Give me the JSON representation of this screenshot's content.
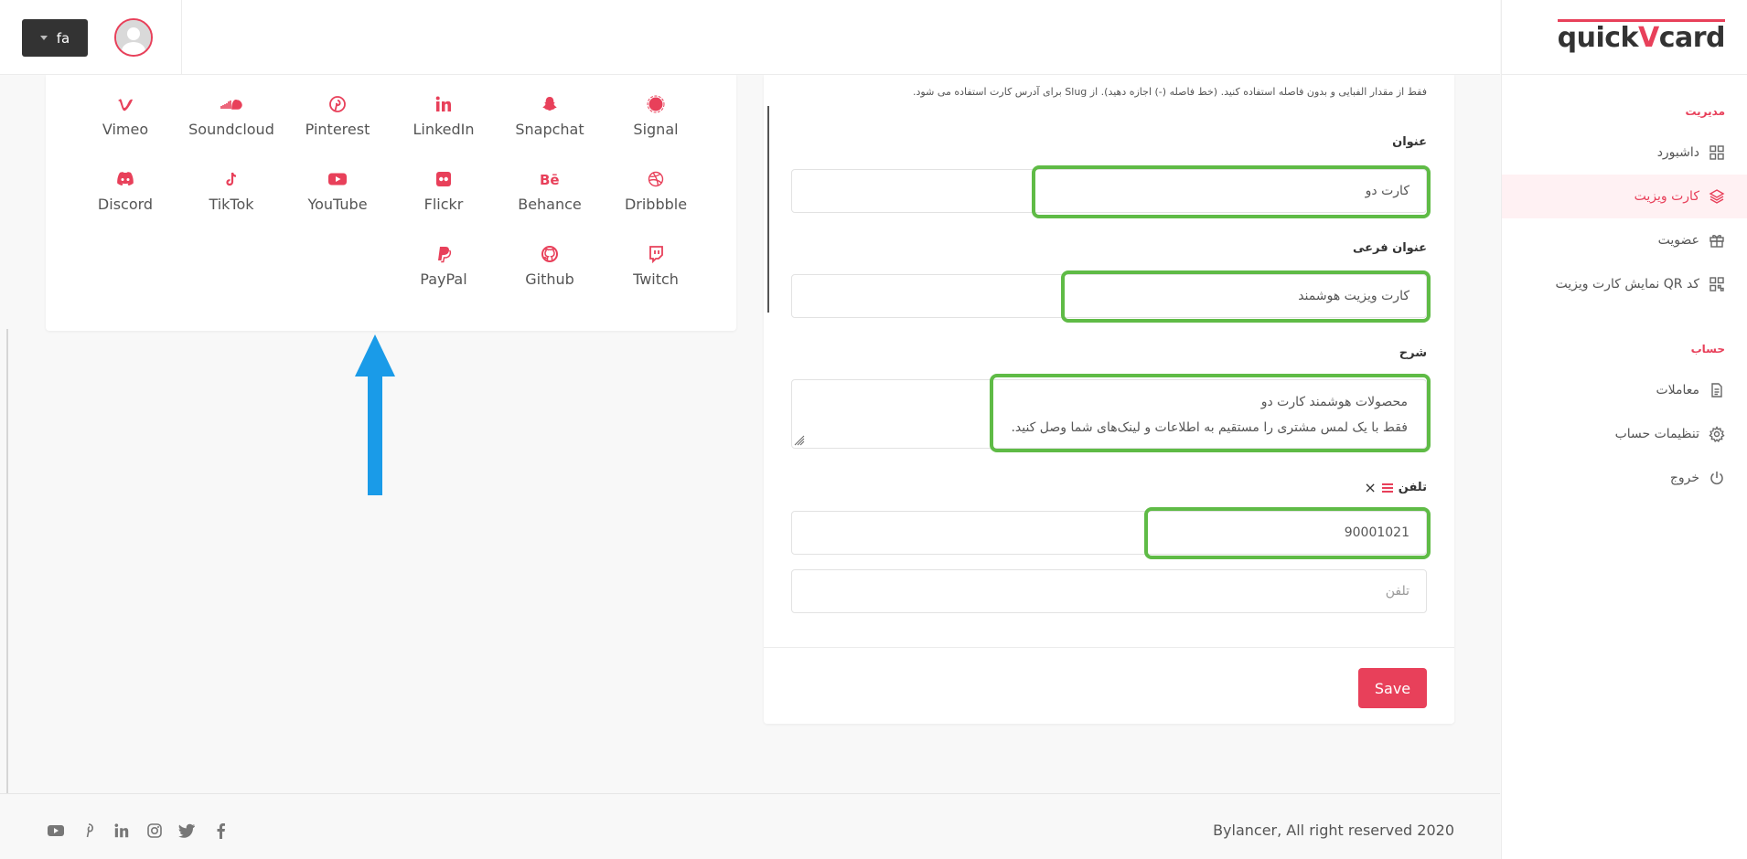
{
  "header": {
    "language_label": "fa",
    "logo_text_a": "quick",
    "logo_text_v": "V",
    "logo_text_b": "card"
  },
  "sidebar": {
    "section_admin": "مدیریت",
    "section_account": "حساب",
    "items": [
      {
        "label": "داشبورد",
        "icon": "dashboard-icon",
        "active": false
      },
      {
        "label": "کارت ویزیت",
        "icon": "layers-icon",
        "active": true
      },
      {
        "label": "عضویت",
        "icon": "gift-icon",
        "active": false
      },
      {
        "label": "کد QR نمایش کارت ویزیت",
        "icon": "qr-icon",
        "active": false
      },
      {
        "label": "معاملات",
        "icon": "document-icon",
        "active": false
      },
      {
        "label": "تنظیمات حساب",
        "icon": "gear-icon",
        "active": false
      },
      {
        "label": "خروج",
        "icon": "power-icon",
        "active": false
      }
    ]
  },
  "social": {
    "items": [
      {
        "label": "Vimeo",
        "icon": "vimeo-icon"
      },
      {
        "label": "Soundcloud",
        "icon": "soundcloud-icon"
      },
      {
        "label": "Pinterest",
        "icon": "pinterest-icon"
      },
      {
        "label": "LinkedIn",
        "icon": "linkedin-icon"
      },
      {
        "label": "Snapchat",
        "icon": "snapchat-icon"
      },
      {
        "label": "Signal",
        "icon": "signal-icon"
      },
      {
        "label": "Discord",
        "icon": "discord-icon"
      },
      {
        "label": "TikTok",
        "icon": "tiktok-icon"
      },
      {
        "label": "YouTube",
        "icon": "youtube-icon"
      },
      {
        "label": "Flickr",
        "icon": "flickr-icon"
      },
      {
        "label": "Behance",
        "icon": "behance-icon"
      },
      {
        "label": "Dribbble",
        "icon": "dribbble-icon"
      },
      {
        "label": "PayPal",
        "icon": "paypal-icon"
      },
      {
        "label": "Github",
        "icon": "github-icon"
      },
      {
        "label": "Twitch",
        "icon": "twitch-icon"
      }
    ]
  },
  "form": {
    "help_text": "فقط از مقدار الفبایی و بدون فاصله استفاده کنید. (خط فاصله (-) اجازه دهید). از Slug برای آدرس کارت استفاده می شود.",
    "title_label": "عنوان",
    "title_value": "کارت دو",
    "subtitle_label": "عنوان فرعی",
    "subtitle_value": "کارت ویزیت هوشمند",
    "description_label": "شرح",
    "description_line1": "محصولات هوشمند کارت دو",
    "description_line2": "فقط با یک لمس مشتری را مستقیم به اطلاعات و لینک‌های شما وصل کنید.",
    "phone_label": "تلفن",
    "phone_value": "90001021",
    "phone_placeholder": "تلفن",
    "save_label": "Save"
  },
  "footer": {
    "copyright": "Bylancer, All right reserved 2020",
    "icons": [
      "youtube-icon",
      "pinterest-icon",
      "linkedin-icon",
      "instagram-icon",
      "twitter-icon",
      "facebook-icon"
    ]
  },
  "colors": {
    "accent": "#e8405a",
    "highlight": "#5fbb46",
    "arrow": "#1a9be8"
  }
}
